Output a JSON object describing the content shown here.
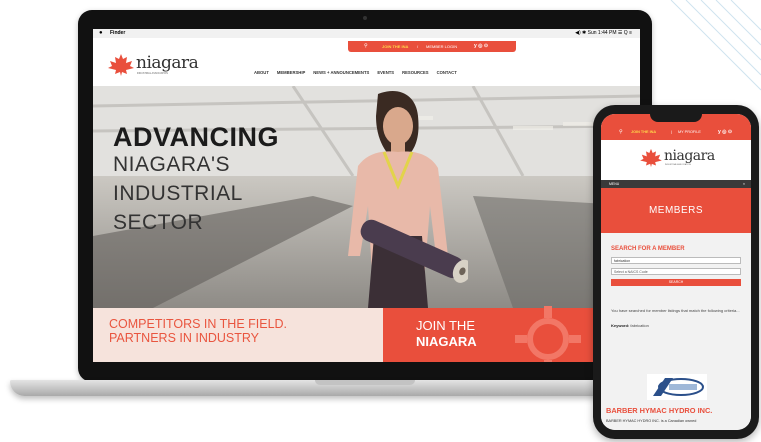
{
  "menubar": {
    "apple": "",
    "app": "Finder",
    "status": "◀)  ✱  Sun 1:44 PM  ☰  Q  ≡"
  },
  "laptop_site": {
    "utility": {
      "search_icon": "⚲",
      "join": "JOIN THE INA",
      "separator": "/",
      "login": "MEMBER LOGIN",
      "social": "y ◎ ⊙"
    },
    "logo": {
      "name": "niagara",
      "tagline": "INDUSTRIAL ASSOCIATION"
    },
    "nav": [
      "ABOUT",
      "MEMBERSHIP",
      "NEWS + ANNOUNCEMENTS",
      "EVENTS",
      "RESOURCES",
      "CONTACT"
    ],
    "hero": {
      "bold": "ADVANCING",
      "line1": "NIAGARA'S",
      "line2": "INDUSTRIAL",
      "line3": "SECTOR"
    },
    "bottom": {
      "left_line1": "COMPETITORS IN THE FIELD.",
      "left_line2": "PARTNERS IN INDUSTRY",
      "right_line1": "JOIN THE",
      "right_line2": "NIAGARA"
    }
  },
  "phone_site": {
    "topbar": {
      "search_icon": "⚲",
      "join": "JOIN THE INA",
      "separator": "|",
      "profile": "MY PROFILE",
      "social": "y ◎ ⊙"
    },
    "logo": {
      "name": "niagara",
      "tagline": "INDUSTRIAL ASSOCIATION"
    },
    "menu": {
      "label": "MENU",
      "close": "×"
    },
    "hero_title": "MEMBERS",
    "search_title": "SEARCH FOR A MEMBER",
    "input_value": "fabrication",
    "select_value": "Select a NAICS Code",
    "search_button": "SEARCH",
    "result_text": "You have searched for member listings that match the following criteria...",
    "keyword_label": "Keyword:",
    "keyword_value": "fabrication",
    "company_name": "BARBER HYMAC HYDRO INC.",
    "company_desc": "BARBER HYMAC HYDRO INC. is a Canadian owned"
  },
  "colors": {
    "brand_red": "#e94f3c",
    "brand_yellow": "#ffd84a"
  }
}
